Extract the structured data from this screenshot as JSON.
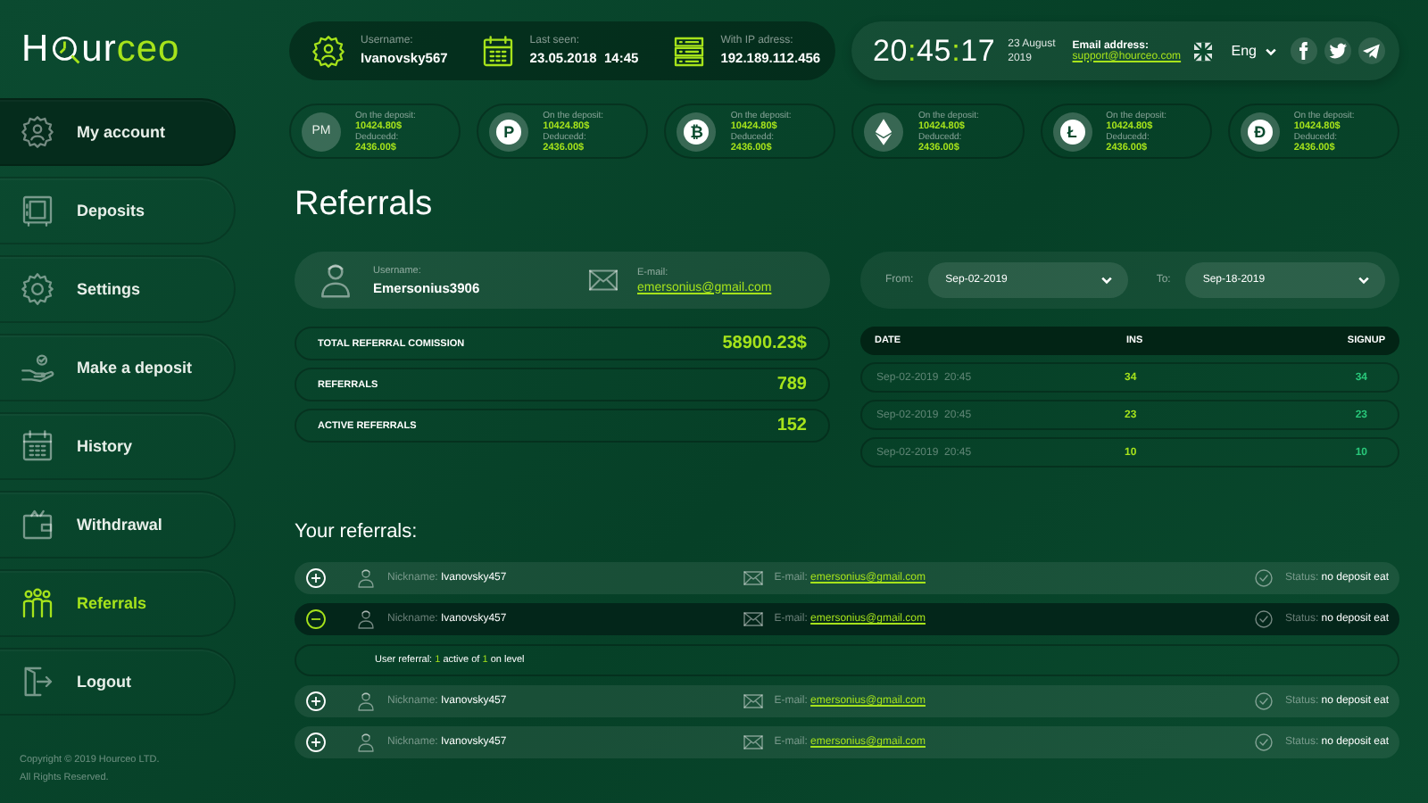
{
  "logo": {
    "start": "H",
    "middle": "ur",
    "accent": "ceo"
  },
  "sidebar": {
    "items": [
      {
        "label": "My account",
        "hovered": true,
        "selected": false
      },
      {
        "label": "Deposits",
        "hovered": false,
        "selected": false
      },
      {
        "label": "Settings",
        "hovered": false,
        "selected": false
      },
      {
        "label": "Make a deposit",
        "hovered": false,
        "selected": false
      },
      {
        "label": "History",
        "hovered": false,
        "selected": false
      },
      {
        "label": "Withdrawal",
        "hovered": false,
        "selected": false
      },
      {
        "label": "Referrals",
        "hovered": false,
        "selected": true
      },
      {
        "label": "Logout",
        "hovered": false,
        "selected": false
      }
    ],
    "copyright": "Copyright © 2019 Hourceo LTD.",
    "rights": "All Rights Reserved."
  },
  "header": {
    "fields": [
      {
        "label": "Username:",
        "value": "Ivanovsky567"
      },
      {
        "label": "Last seen:",
        "value": "23.05.2018  14:45"
      },
      {
        "label": "With IP adress:",
        "value": "192.189.112.456"
      }
    ],
    "clock": {
      "hours": "20",
      "minutes": "45",
      "seconds": "17",
      "separator": ":"
    },
    "date": "23 August 2019",
    "email_label": "Email address:",
    "email": "support@hourceo.com",
    "language": "Eng"
  },
  "wallets": [
    {
      "symbol": "PM",
      "kind": "text",
      "deposit_label": "On the deposit:",
      "deposit": "10424.80$",
      "deducted_label": "Deducedd:",
      "deducted": "2436.00$"
    },
    {
      "symbol": "P",
      "kind": "coin",
      "deposit_label": "On the deposit:",
      "deposit": "10424.80$",
      "deducted_label": "Deducedd:",
      "deducted": "2436.00$"
    },
    {
      "symbol": "₿",
      "kind": "coin",
      "deposit_label": "On the deposit:",
      "deposit": "10424.80$",
      "deducted_label": "Deducedd:",
      "deducted": "2436.00$"
    },
    {
      "kind": "ethereum",
      "deposit_label": "On the deposit:",
      "deposit": "10424.80$",
      "deducted_label": "Deducedd:",
      "deducted": "2436.00$"
    },
    {
      "symbol": "Ł",
      "kind": "coin",
      "deposit_label": "On the deposit:",
      "deposit": "10424.80$",
      "deducted_label": "Deducedd:",
      "deducted": "2436.00$"
    },
    {
      "symbol": "Đ",
      "kind": "coin",
      "deposit_label": "On the deposit:",
      "deposit": "10424.80$",
      "deducted_label": "Deducedd:",
      "deducted": "2436.00$"
    }
  ],
  "page": {
    "title": "Referrals"
  },
  "profile": {
    "username_label": "Username:",
    "username": "Emersonius3906",
    "email_label": "E-mail:",
    "email": "emersonius@gmail.com"
  },
  "date_filter": {
    "from_label": "From:",
    "from": "Sep-02-2019",
    "to_label": "To:",
    "to": "Sep-18-2019"
  },
  "stats": [
    {
      "label": "TOTAL REFERRAL COMISSION",
      "value": "58900.23$"
    },
    {
      "label": "REFERRALS",
      "value": "789"
    },
    {
      "label": "ACTIVE REFERRALS",
      "value": "152"
    }
  ],
  "table": {
    "columns": [
      "DATE",
      "INS",
      "SIGNUP"
    ],
    "rows": [
      [
        "Sep-02-2019  20:45",
        "34",
        "34"
      ],
      [
        "Sep-02-2019  20:45",
        "23",
        "23"
      ],
      [
        "Sep-02-2019  20:45",
        "10",
        "10"
      ]
    ]
  },
  "referrals": {
    "title": "Your referrals:",
    "rows": [
      {
        "expanded": false,
        "nickname_label": "Nickname:",
        "nickname": "Ivanovsky457",
        "email_label": "E-mail:",
        "email": "emersonius@gmail.com",
        "status_label": "Status:",
        "status": "no deposit eat"
      },
      {
        "expanded": true,
        "nickname_label": "Nickname:",
        "nickname": "Ivanovsky457",
        "email_label": "E-mail:",
        "email": "emersonius@gmail.com",
        "status_label": "Status:",
        "status": "no deposit eat",
        "detail": "User referral: **1** active of **1** on level"
      },
      {
        "expanded": false,
        "nickname_label": "Nickname:",
        "nickname": "Ivanovsky457",
        "email_label": "E-mail:",
        "email": "emersonius@gmail.com",
        "status_label": "Status:",
        "status": "no deposit eat"
      },
      {
        "expanded": false,
        "nickname_label": "Nickname:",
        "nickname": "Ivanovsky457",
        "email_label": "E-mail:",
        "email": "emersonius@gmail.com",
        "status_label": "Status:",
        "status": "no deposit eat"
      }
    ]
  }
}
